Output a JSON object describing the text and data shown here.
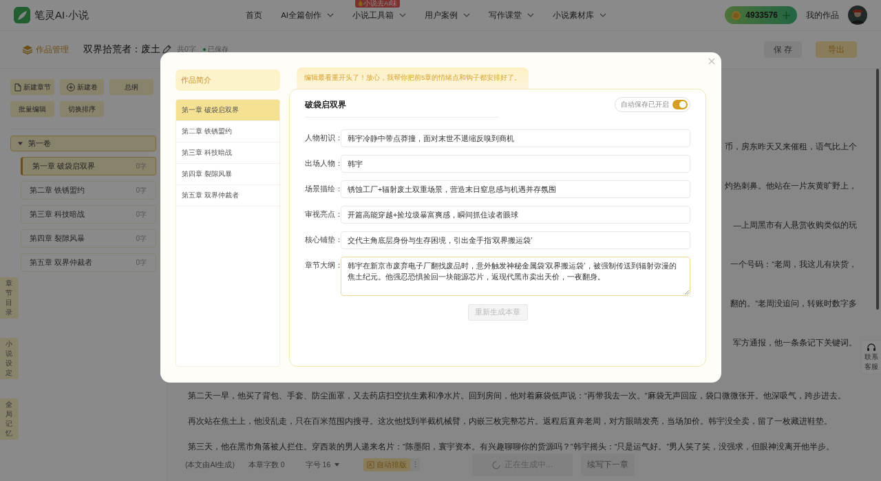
{
  "header": {
    "logo_text": "笔灵AI·小说",
    "nav": [
      {
        "label": "首页",
        "dropdown": false
      },
      {
        "label": "AI全篇创作",
        "dropdown": true
      },
      {
        "label": "小说工具箱",
        "dropdown": true,
        "badge": "小说去AI味"
      },
      {
        "label": "用户案例",
        "dropdown": true
      },
      {
        "label": "写作课堂",
        "dropdown": true
      },
      {
        "label": "小说素材库",
        "dropdown": true
      }
    ],
    "points": "4933576",
    "my_works": "我的作品"
  },
  "toolbar": {
    "manage": "作品管理",
    "title": "双界拾荒者：废土",
    "word_count": "共0字",
    "save_status": "已保存",
    "buttons": [
      {
        "label": "保 存",
        "kind": "secondary"
      },
      {
        "label": "导出",
        "kind": "primary"
      }
    ]
  },
  "sidebar": {
    "actions": [
      {
        "label": "新建章节",
        "kind": "doc"
      },
      {
        "label": "新建卷",
        "kind": "plus"
      },
      {
        "label": "总纲",
        "kind": "plain"
      },
      {
        "label": "批量编辑",
        "kind": "plain"
      },
      {
        "label": "切换排序",
        "kind": "plain"
      }
    ],
    "volumes": [
      {
        "label": "第一卷",
        "expanded": true,
        "children": [
          {
            "label": "第一章 破袋启双界",
            "count": "0字",
            "selected": true
          },
          {
            "label": "第二章 铁锈盟约",
            "count": "0字",
            "selected": false
          },
          {
            "label": "第三章 科技暗战",
            "count": "0字",
            "selected": false
          },
          {
            "label": "第四章 裂隙风暴",
            "count": "0字",
            "selected": false
          },
          {
            "label": "第五章 双界仲裁者",
            "count": "0字",
            "selected": false
          }
        ]
      }
    ],
    "side_tabs": [
      "章节目录",
      "小说设定",
      "全局记忆"
    ]
  },
  "editor": {
    "partial_lines": [
      "币，房东昨天又来催租，语气比上个",
      "灼热刺鼻。他站在一片灰黄旷野上，",
      "—上周黑市有人悬赏收购类似的玩",
      "一个号码：“老周，我这儿有块货，",
      "翻的。”老周没追问，转账时数字多",
      "军方通报，他一条条记下关键词。"
    ],
    "paragraphs": [
      "第二天一早，他买了背包、手套、防尘面罩，又去药店扫空抗生素和净水片。回到房间，他对着麻袋低声说：“再带我去一次。”麻袋无声回应，袋口微微张开。他深吸气，跨步进去。",
      "再次站在焦土上，他没乱走，只在百米范围内搜寻。这次他找到半截机械臂，内嵌三枚完整芯片。返程后直奔老周，对方眼睛发亮，当场加价。韩宇没全卖，留了一枚藏进鞋垫。",
      "第三天，他在黑市角落被人拦住。穿西装的男人递来名片：“陈墨阳，寰宇资本。有兴趣聊聊你的货源吗？”韩宇摇头：“只是运气好。”男人笑了笑，没强求，但眼神没离开他半步。"
    ]
  },
  "footer": {
    "note": "(本文由AI生成)",
    "chapter_words": "本章字数 0",
    "font_size": "字号 16",
    "auto_format": "自动排版",
    "more": "⋮",
    "generating": "正在生成中...",
    "continue": "续写下一章"
  },
  "support": "联系客服",
  "modal": {
    "intro_tab": "作品简介",
    "chapters": [
      {
        "label": "第一章 破袋启双界",
        "selected": true
      },
      {
        "label": "第二章 铁锈盟约",
        "selected": false
      },
      {
        "label": "第三章 科技暗战",
        "selected": false
      },
      {
        "label": "第四章 裂隙风暴",
        "selected": false
      },
      {
        "label": "第五章 双界仲裁者",
        "selected": false
      }
    ],
    "tip": "编辑最看重开头了！放心，我帮你把前5章的情绪点和钩子都安排好了。",
    "card": {
      "title": "破袋启双界",
      "autosave": {
        "label": "自动保存已开启",
        "on": true
      },
      "fields": [
        {
          "label": "人物初识：",
          "value": "韩宇冷静中带点莽撞，面对末世不退缩反嗅到商机",
          "kind": "input"
        },
        {
          "label": "出场人物：",
          "value": "韩宇",
          "kind": "input"
        },
        {
          "label": "场景描绘：",
          "value": "锈蚀工厂+辐射废土双重场景，营造末日窒息感与机遇并存氛围",
          "kind": "input"
        },
        {
          "label": "审视亮点：",
          "value": "开篇高能穿越+捡垃圾暴富爽感，瞬间抓住读者眼球",
          "kind": "input"
        },
        {
          "label": "核心铺垫：",
          "value": "交代主角底层身份与生存困境，引出金手指‘双界搬运袋’",
          "kind": "input"
        },
        {
          "label": "章节大纲：",
          "value": "韩宇在新京市废弃电子厂翻找废品时，意外触发神秘金属袋‘双界搬运袋’，被强制传送到辐射弥漫的焦土纪元。他强忍恐惧捡回一块能源芯片，返现代黑市卖出天价，一夜翻身。",
          "kind": "textarea"
        }
      ],
      "regenerate": {
        "label": "重新生成本章",
        "disabled": true
      }
    }
  }
}
